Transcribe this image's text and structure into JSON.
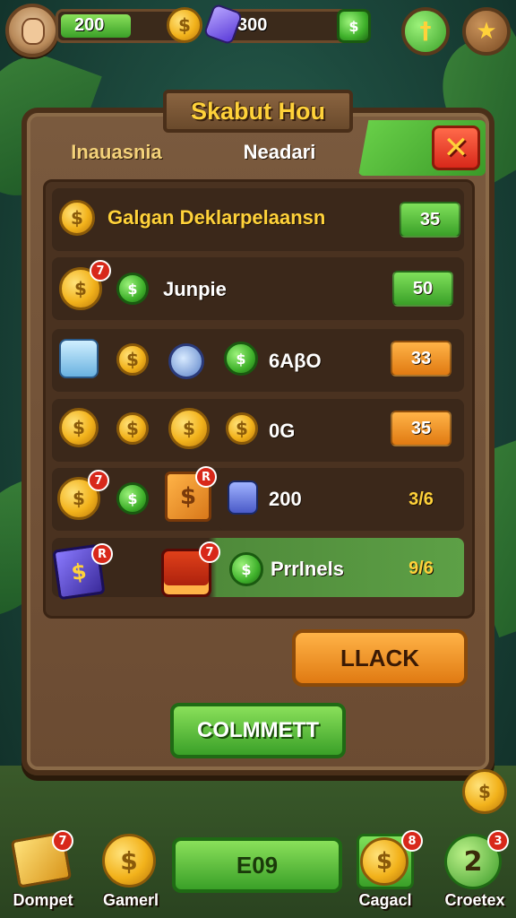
{
  "hud": {
    "gold_value": "200",
    "gem_value": "300"
  },
  "shop": {
    "title": "Skabut Hou",
    "tabs": [
      "Inauasnia",
      "Neadari"
    ],
    "close_symbol": "✕",
    "rows": [
      {
        "label": "Galgan Deklarpelaansn",
        "price": "35"
      },
      {
        "label": "Junpie",
        "price": "50"
      },
      {
        "label": "6AβO",
        "price": "33"
      },
      {
        "label": "0G",
        "price": "35"
      },
      {
        "label": "200",
        "price": "3/6"
      },
      {
        "label": "Prrlnels",
        "price": "9/6"
      }
    ],
    "lack_button": "LLACK",
    "commit_button": "COLMMETT"
  },
  "nav": {
    "items": [
      {
        "label": "Dompet",
        "badge": "7"
      },
      {
        "label": "Gamerl"
      },
      {
        "label": "E09"
      },
      {
        "label": "Cagacl",
        "badge": "8"
      },
      {
        "label": "Croetex",
        "badge": "3"
      }
    ]
  },
  "colors": {
    "accent_gold": "#ffd23a",
    "button_green": "#3aa028",
    "button_orange": "#e07a12",
    "close_red": "#d8281a",
    "wood": "#6b4b32"
  }
}
